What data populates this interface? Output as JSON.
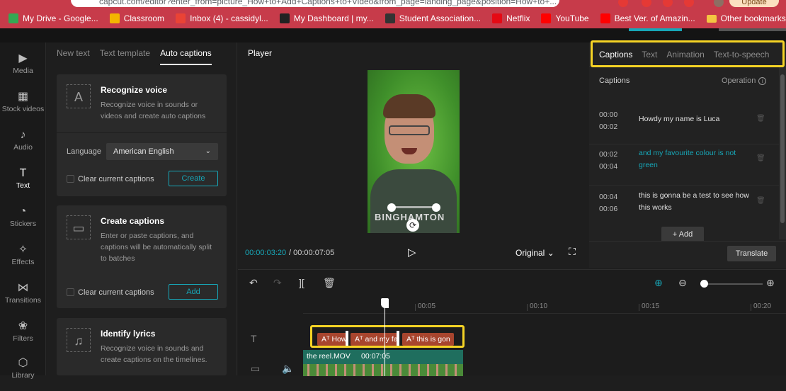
{
  "browser": {
    "url": "capcut.com/editor?enter_from=picture_How+to+Add+Captions+to+Video&from_page=landing_page&position=How+to+...",
    "update_label": "Update",
    "bookmarks": [
      {
        "label": "My Drive - Google...",
        "color": "#34a853"
      },
      {
        "label": "Classroom",
        "color": "#f4b400"
      },
      {
        "label": "Inbox (4) - cassidyl...",
        "color": "#ea4335"
      },
      {
        "label": "My Dashboard | my...",
        "color": "#222222"
      },
      {
        "label": "Student Association...",
        "color": "#333333"
      },
      {
        "label": "Netflix",
        "color": "#e50914"
      },
      {
        "label": "YouTube",
        "color": "#ff0000"
      },
      {
        "label": "Best Ver. of Amazin...",
        "color": "#ff0000"
      }
    ],
    "other_bookmarks": "Other bookmarks"
  },
  "rail": {
    "items": [
      {
        "label": "Media",
        "icon": "media-icon",
        "glyph": "▶"
      },
      {
        "label": "Stock videos",
        "icon": "stock-videos-icon",
        "glyph": "▦"
      },
      {
        "label": "Audio",
        "icon": "audio-icon",
        "glyph": "♪"
      },
      {
        "label": "Text",
        "icon": "text-icon",
        "glyph": "T"
      },
      {
        "label": "Stickers",
        "icon": "stickers-icon",
        "glyph": "◔"
      },
      {
        "label": "Effects",
        "icon": "effects-icon",
        "glyph": "✧"
      },
      {
        "label": "Transitions",
        "icon": "transitions-icon",
        "glyph": "⋈"
      },
      {
        "label": "Filters",
        "icon": "filters-icon",
        "glyph": "❀"
      },
      {
        "label": "Library",
        "icon": "library-icon",
        "glyph": "⬡"
      }
    ],
    "active": "Text"
  },
  "text_panel": {
    "tabs": [
      "New text",
      "Text template",
      "Auto captions"
    ],
    "active_tab": "Auto captions",
    "recognize": {
      "title": "Recognize voice",
      "desc": "Recognize voice in sounds or videos and create auto captions",
      "language_label": "Language",
      "language_value": "American English",
      "clear_label": "Clear current captions",
      "button": "Create"
    },
    "create": {
      "title": "Create captions",
      "desc": "Enter or paste captions, and captions will be automatically split to batches",
      "clear_label": "Clear current captions",
      "button": "Add"
    },
    "lyrics": {
      "title": "Identify lyrics",
      "desc": "Recognize voice in sounds and create captions on the timelines."
    }
  },
  "player": {
    "title": "Player",
    "current_time": "00:00:03:20",
    "separator": "/",
    "total_time": "00:00:07:05",
    "ratio": "Original",
    "hoodie_text": "BINGHAMTON"
  },
  "captions_panel": {
    "tabs": [
      "Captions",
      "Text",
      "Animation",
      "Text-to-speech"
    ],
    "active_tab": "Captions",
    "col_left": "Captions",
    "col_right": "Operation",
    "rows": [
      {
        "start": "00:00",
        "end": "00:02",
        "text": "Howdy my name is Luca",
        "active": false
      },
      {
        "start": "00:02",
        "end": "00:04",
        "text": "and my favourite colour is not green",
        "active": true
      },
      {
        "start": "00:04",
        "end": "00:06",
        "text": "this is gonna be a test to see how this works",
        "active": false
      }
    ],
    "add_label": "+ Add",
    "translate_label": "Translate"
  },
  "timeline": {
    "ruler_labels": [
      "00:05",
      "00:10",
      "00:15",
      "00:20"
    ],
    "text_clips": [
      "How",
      "and my fa",
      "this is gon"
    ],
    "video_clip": {
      "name": "the reel.MOV",
      "duration": "00:07:05"
    }
  },
  "colors": {
    "accent": "#17a7b8",
    "highlight": "#f5d325",
    "clip": "#a8452e",
    "chrome": "#c73b4a"
  }
}
